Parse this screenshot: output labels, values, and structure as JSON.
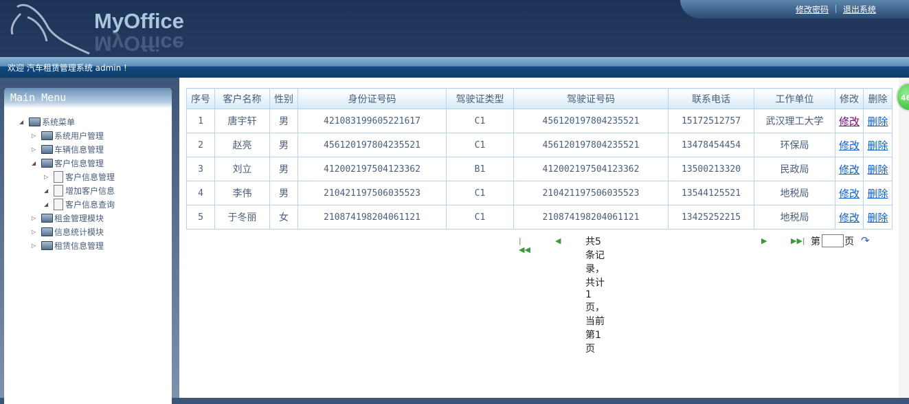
{
  "header": {
    "logo": "MyOffice",
    "change_password": "修改密码",
    "logout": "退出系统"
  },
  "welcome": "欢迎 汽车租赁管理系统 admin !",
  "sidebar": {
    "title": "Main Menu",
    "tree": [
      {
        "label": "系统菜单"
      },
      {
        "label": "系统用户管理"
      },
      {
        "label": "车辆信息管理"
      },
      {
        "label": "客户信息管理"
      },
      {
        "label": "客户信息管理"
      },
      {
        "label": "增加客户信息"
      },
      {
        "label": "客户信息查询"
      },
      {
        "label": "租金管理模块"
      },
      {
        "label": "信息统计模块"
      },
      {
        "label": "租赁信息管理"
      }
    ]
  },
  "badge": "46",
  "table": {
    "headers": [
      "序号",
      "客户名称",
      "性别",
      "身份证号码",
      "驾驶证类型",
      "驾驶证号码",
      "联系电话",
      "工作单位",
      "修改",
      "删除"
    ],
    "rows": [
      [
        "1",
        "唐宇轩",
        "男",
        "421083199605221617",
        "C1",
        "456120197804235521",
        "15172512757",
        "武汉理工大学",
        "修改",
        "删除"
      ],
      [
        "2",
        "赵亮",
        "男",
        "456120197804235521",
        "C1",
        "456120197804235521",
        "13478454454",
        "环保局",
        "修改",
        "删除"
      ],
      [
        "3",
        "刘立",
        "男",
        "412002197504123362",
        "B1",
        "412002197504123362",
        "13500213320",
        "民政局",
        "修改",
        "删除"
      ],
      [
        "4",
        "李伟",
        "男",
        "210421197506035523",
        "C1",
        "210421197506035523",
        "13544125521",
        "地税局",
        "修改",
        "删除"
      ],
      [
        "5",
        "于冬丽",
        "女",
        "210874198204061121",
        "C1",
        "210874198204061121",
        "13425252215",
        "地税局",
        "修改",
        "删除"
      ]
    ]
  },
  "pager": {
    "summary": "共5条记录， 共计1页，当前第1页",
    "page_prefix": "第",
    "page_suffix": "页",
    "page_value": ""
  }
}
